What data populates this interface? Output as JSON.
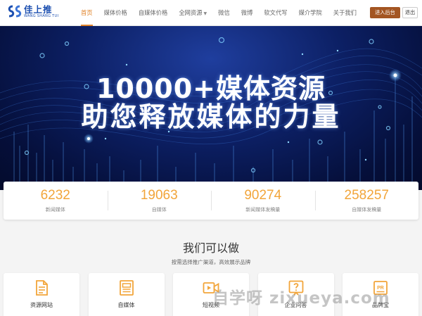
{
  "brand": {
    "name_cn": "佳上推",
    "name_en": "WANG SHANG TUI",
    "logo_mark": "SS",
    "color": "#1c4fb0"
  },
  "nav": {
    "items": [
      {
        "label": "首页",
        "active": true
      },
      {
        "label": "媒体价格"
      },
      {
        "label": "自媒体价格"
      },
      {
        "label": "全网资源"
      },
      {
        "label": "微信"
      },
      {
        "label": "微博"
      },
      {
        "label": "软文代写"
      },
      {
        "label": "媒介学院"
      },
      {
        "label": "关于我们"
      }
    ],
    "accent": "#e0832a"
  },
  "header_actions": {
    "admin_label": "进入后台",
    "logout_label": "退出",
    "admin_color": "#a35522"
  },
  "hero": {
    "line1": "10000+媒体资源",
    "line2": "助您释放媒体的力量"
  },
  "stats": [
    {
      "value": "6232",
      "label": "新闻媒体"
    },
    {
      "value": "19063",
      "label": "自媒体"
    },
    {
      "value": "90274",
      "label": "新闻媒体发稿量"
    },
    {
      "value": "258257",
      "label": "自媒体发稿量"
    }
  ],
  "section": {
    "title": "我们可以做",
    "subtitle": "按需选择推广渠道，高效展示品牌",
    "cards": [
      {
        "label": "资源网站",
        "icon": "document-icon"
      },
      {
        "label": "自媒体",
        "icon": "article-icon"
      },
      {
        "label": "短视频",
        "icon": "video-icon"
      },
      {
        "label": "企业问答",
        "icon": "question-icon"
      },
      {
        "label": "品牌宝",
        "icon": "pr-icon"
      }
    ],
    "icon_color": "#f2a53a"
  },
  "watermark": "自学呀 zixueya.com"
}
